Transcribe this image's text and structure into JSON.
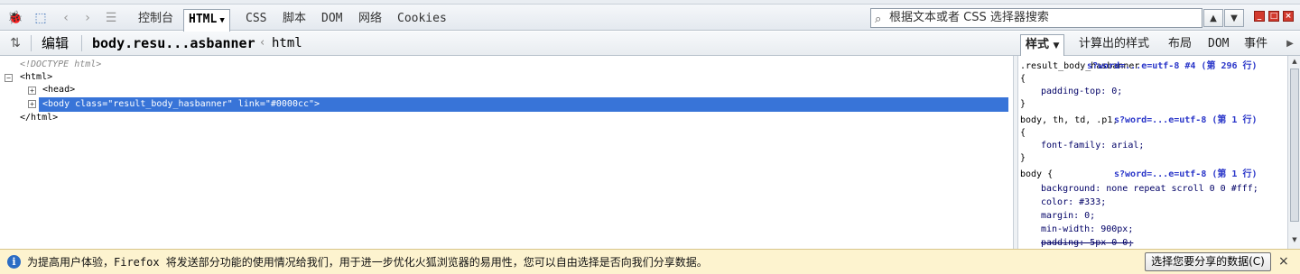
{
  "toolbar": {
    "tabs": [
      {
        "label": "控制台"
      },
      {
        "label": "HTML"
      },
      {
        "label": "CSS"
      },
      {
        "label": "脚本"
      },
      {
        "label": "DOM"
      },
      {
        "label": "网络"
      },
      {
        "label": "Cookies"
      }
    ],
    "search_placeholder": "根据文本或者 CSS 选择器搜索",
    "icons": [
      "firebug-icon",
      "inspect-icon",
      "back-icon",
      "forward-icon",
      "more-icon",
      "search-icon",
      "chevron-up-icon",
      "chevron-down-icon",
      "minimize-icon",
      "detach-icon",
      "close-icon"
    ]
  },
  "breadcrumb": {
    "edit_label": "编辑",
    "items": [
      "body.resu...asbanner",
      "html"
    ],
    "separator": "‹"
  },
  "side_tabs": [
    {
      "label": "样式"
    },
    {
      "label": "计算出的样式"
    },
    {
      "label": "布局"
    },
    {
      "label": "DOM"
    },
    {
      "label": "事件"
    }
  ],
  "html_tree": {
    "doctype": "<!DOCTYPE html>",
    "html_open": "<html>",
    "head": "<head>",
    "body": "<body class=\"result_body_hasbanner\" link=\"#0000cc\">",
    "html_close": "</html>"
  },
  "styles": [
    {
      "selector": ".result_body_hasbanner",
      "source": "s?word=...e=utf-8 #4 (第 296 行)",
      "open": "{",
      "props": [
        {
          "text": "padding-top: 0;"
        }
      ],
      "close": "}"
    },
    {
      "selector": "body, th, td, .p1,",
      "source": "s?word=...e=utf-8 (第 1 行)",
      "open": "{",
      "props": [
        {
          "text": "font-family: arial;"
        }
      ],
      "close": "}"
    },
    {
      "selector": "body {",
      "source": "s?word=...e=utf-8 (第 1 行)",
      "props": [
        {
          "text": "background: none repeat scroll 0 0 #fff;"
        },
        {
          "text": "color: #333;"
        },
        {
          "text": "margin: 0;"
        },
        {
          "text": "min-width: 900px;"
        },
        {
          "text": "padding: 5px 0 0;"
        }
      ]
    }
  ],
  "infobar": {
    "message": "为提高用户体验，Firefox 将发送部分功能的使用情况给我们，用于进一步优化火狐浏览器的易用性，您可以自由选择是否向我们分享数据。",
    "button_label": "选择您要分享的数据(C)",
    "close_label": "×"
  },
  "colors": {
    "selection": "#3874d8",
    "source_link": "#2a36c9",
    "infobar_bg": "#fdf3cf"
  }
}
